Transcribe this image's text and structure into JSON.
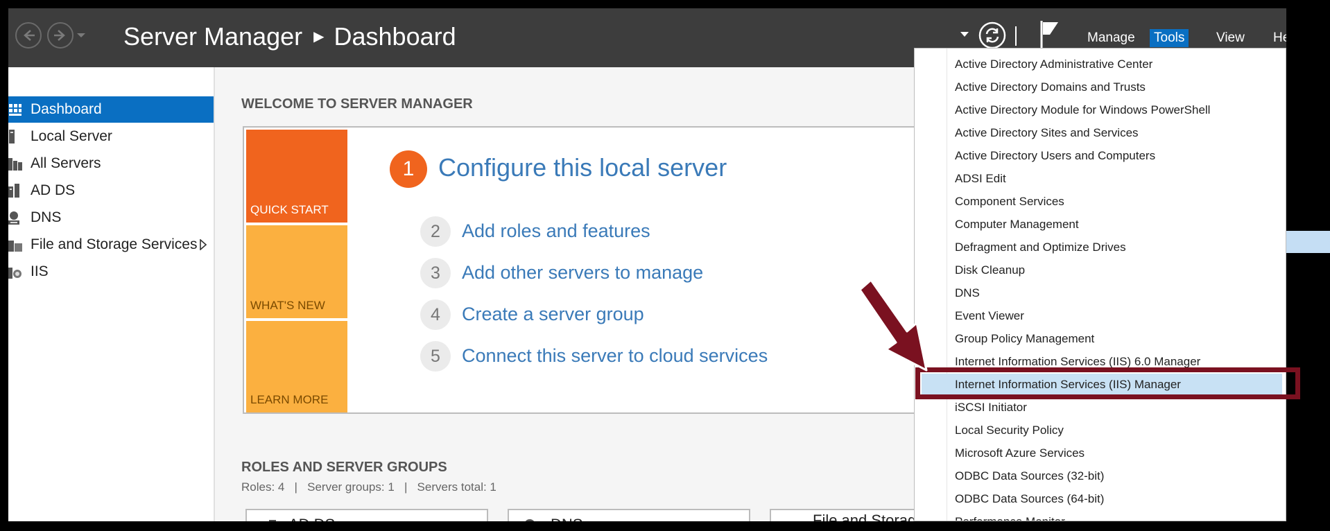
{
  "titlebar": {
    "app": "Server Manager",
    "page": "Dashboard",
    "menu": [
      {
        "label": "Manage",
        "active": false
      },
      {
        "label": "Tools",
        "active": true
      },
      {
        "label": "View",
        "active": false
      },
      {
        "label": "Help",
        "active": false
      }
    ]
  },
  "sidebar": {
    "items": [
      {
        "label": "Dashboard",
        "icon": "dashboard-icon",
        "selected": true
      },
      {
        "label": "Local Server",
        "icon": "server-icon"
      },
      {
        "label": "All Servers",
        "icon": "servers-icon"
      },
      {
        "label": "AD DS",
        "icon": "ad-ds-icon"
      },
      {
        "label": "DNS",
        "icon": "dns-icon"
      },
      {
        "label": "File and Storage Services",
        "icon": "storage-icon",
        "expandable": true
      },
      {
        "label": "IIS",
        "icon": "iis-icon"
      }
    ]
  },
  "welcome": {
    "heading": "WELCOME TO SERVER MANAGER",
    "tiles": [
      "QUICK START",
      "WHAT'S NEW",
      "LEARN MORE"
    ],
    "main_step": {
      "num": "1",
      "label": "Configure this local server"
    },
    "steps": [
      {
        "num": "2",
        "label": "Add roles and features"
      },
      {
        "num": "3",
        "label": "Add other servers to manage"
      },
      {
        "num": "4",
        "label": "Create a server group"
      },
      {
        "num": "5",
        "label": "Connect this server to cloud services"
      }
    ]
  },
  "roles": {
    "heading": "ROLES AND SERVER GROUPS",
    "meta": "Roles: 4   |   Server groups: 1   |   Servers total: 1",
    "cards": [
      "AD DS",
      "DNS",
      "File and Storage Services"
    ]
  },
  "tools_menu": {
    "items": [
      "Active Directory Administrative Center",
      "Active Directory Domains and Trusts",
      "Active Directory Module for Windows PowerShell",
      "Active Directory Sites and Services",
      "Active Directory Users and Computers",
      "ADSI Edit",
      "Component Services",
      "Computer Management",
      "Defragment and Optimize Drives",
      "Disk Cleanup",
      "DNS",
      "Event Viewer",
      "Group Policy Management",
      "Internet Information Services (IIS) 6.0 Manager",
      "Internet Information Services (IIS) Manager",
      "iSCSI Initiator",
      "Local Security Policy",
      "Microsoft Azure Services",
      "ODBC Data Sources (32-bit)",
      "ODBC Data Sources (64-bit)",
      "Performance Monitor"
    ],
    "highlighted": "Internet Information Services (IIS) Manager"
  },
  "colors": {
    "titlebar": "#3d3d3d",
    "accent": "#0a6fc2",
    "quick_start": "#f0641e",
    "tile_secondary": "#fbb040",
    "link": "#3a7ab8",
    "annotation": "#7a1120"
  }
}
